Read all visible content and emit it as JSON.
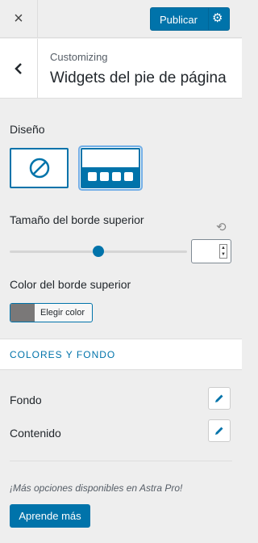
{
  "header": {
    "close_icon": "×",
    "publish_label": "Publicar",
    "settings_icon": "⚙"
  },
  "section": {
    "breadcrumb": "Customizing",
    "title": "Widgets del pie de página"
  },
  "layout": {
    "label": "Diseño",
    "options": [
      "disabled",
      "four-columns"
    ],
    "selected": "four-columns"
  },
  "border_size": {
    "label": "Tamaño del borde superior",
    "reset_icon": "⟲",
    "slider_value_fraction": 0.5,
    "input_value": ""
  },
  "border_color": {
    "label": "Color del borde superior",
    "button_label": "Elegir color",
    "swatch_color": "#7a7878"
  },
  "colors_section": {
    "heading": "COLORES Y FONDO",
    "rows": [
      {
        "label": "Fondo"
      },
      {
        "label": "Contenido"
      }
    ]
  },
  "promo": {
    "text": "¡Más opciones disponibles en Astra Pro!",
    "button_label": "Aprende más"
  },
  "colors": {
    "accent": "#0073aa",
    "background": "#eeeeee"
  }
}
